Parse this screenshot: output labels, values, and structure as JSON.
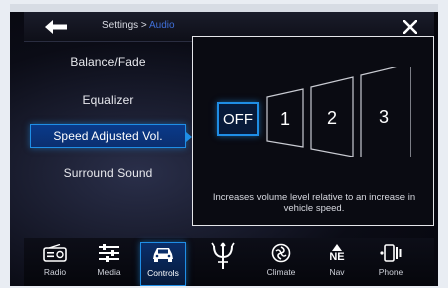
{
  "colors": {
    "accent": "#1f8ee6",
    "breadcrumb_current": "#3f6fd9",
    "background": "#0b0c16"
  },
  "header": {
    "back_icon": "back-arrow-icon",
    "breadcrumb_parent": "Settings > ",
    "breadcrumb_current": "Audio",
    "close_icon": "close-icon"
  },
  "menu": {
    "items": [
      {
        "label": "Balance/Fade",
        "selected": false
      },
      {
        "label": "Equalizer",
        "selected": false
      },
      {
        "label": "Speed Adjusted Vol.",
        "selected": true
      },
      {
        "label": "Surround Sound",
        "selected": false
      }
    ],
    "scroll_icon": "chevron-down-icon"
  },
  "panel": {
    "levels": [
      "OFF",
      "1",
      "2",
      "3"
    ],
    "selected_level": "OFF",
    "description": "Increases volume level relative to an increase in vehicle speed."
  },
  "dock": {
    "items": [
      {
        "label": "Radio",
        "icon": "radio-icon",
        "active": false
      },
      {
        "label": "Media",
        "icon": "media-icon",
        "active": false
      },
      {
        "label": "Controls",
        "icon": "car-icon",
        "active": true
      },
      {
        "label": "",
        "icon": "trident-logo-icon",
        "active": false
      },
      {
        "label": "Climate",
        "icon": "climate-icon",
        "active": false
      },
      {
        "label": "Nav",
        "icon": "compass-ne-icon",
        "icon_text": "NE",
        "active": false
      },
      {
        "label": "Phone",
        "icon": "phone-icon",
        "active": false
      }
    ]
  }
}
